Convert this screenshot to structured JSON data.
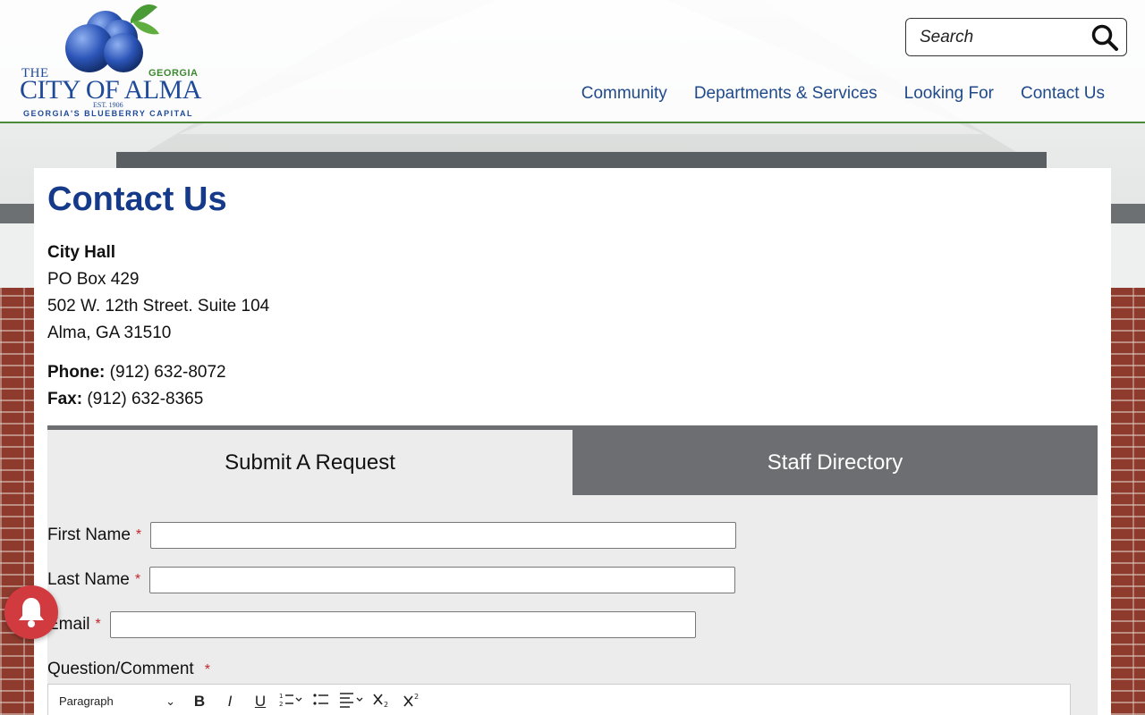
{
  "logo": {
    "the": "THE",
    "georgia": "GEORGIA",
    "city": "CITY OF ALMA",
    "est": "EST. 1906",
    "tagline": "GEORGIA'S BLUEBERRY CAPITAL"
  },
  "search": {
    "placeholder": "Search",
    "icon": "search-icon"
  },
  "nav": {
    "items": [
      {
        "label": "Community"
      },
      {
        "label": "Departments & Services"
      },
      {
        "label": "Looking For"
      },
      {
        "label": "Contact Us"
      }
    ]
  },
  "main": {
    "title": "Contact Us",
    "address": {
      "name": "City Hall",
      "line1": "PO Box 429",
      "line2": "502 W. 12th Street. Suite 104",
      "line3": "Alma, GA 31510"
    },
    "phone_label": "Phone:",
    "phone": "(912) 632-8072",
    "fax_label": "Fax:",
    "fax": "(912) 632-8365"
  },
  "tabs": [
    {
      "label": "Submit A Request",
      "active": true
    },
    {
      "label": "Staff Directory",
      "active": false
    }
  ],
  "form": {
    "first_name_label": "First Name",
    "last_name_label": "Last Name",
    "email_label": "Email",
    "required_mark": "*",
    "question_label": "Question/Comment",
    "editor": {
      "format": "Paragraph",
      "buttons": [
        "B",
        "I",
        "U"
      ]
    }
  },
  "colors": {
    "title": "#163a8a",
    "nav": "#1f4a8a",
    "tab_inactive": "#6d6e71",
    "required": "#c0272d",
    "alert_bell": "#d13b3f"
  }
}
